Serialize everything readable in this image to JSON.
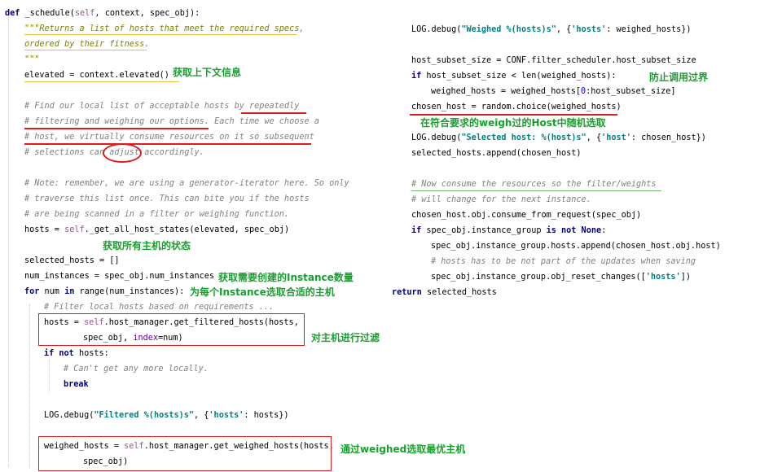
{
  "code_left": [
    [
      "def _schedule(self, context, spec_obj):"
    ],
    [
      "\"\"\"Returns a list of hosts that meet the required specs,"
    ],
    [
      "ordered by their fitness."
    ],
    [
      "\"\"\""
    ],
    [
      "elevated = context.elevated()"
    ],
    [
      "# Find our local list of acceptable hosts by repeatedly"
    ],
    [
      "# filtering and weighing our options. Each time we choose a"
    ],
    [
      "# host, we virtually consume resources on it so subsequent"
    ],
    [
      "# selections can adjust accordingly."
    ],
    [
      "# Note: remember, we are using a generator-iterator here. So only"
    ],
    [
      "# traverse this list once. This can bite you if the hosts"
    ],
    [
      "# are being scanned in a filter or weighing function."
    ],
    [
      "hosts = self._get_all_host_states(elevated, spec_obj)"
    ],
    [
      "selected_hosts = []"
    ],
    [
      "num_instances = spec_obj.num_instances"
    ],
    [
      "for num in range(num_instances):"
    ],
    [
      "# Filter local hosts based on requirements ..."
    ],
    [
      "hosts = self.host_manager.get_filtered_hosts(hosts,"
    ],
    [
      "spec_obj, index=num)"
    ],
    [
      "if not hosts:"
    ],
    [
      "# Can't get any more locally."
    ],
    [
      "break"
    ],
    [
      "LOG.debug(\"Filtered %(hosts)s\", {'hosts': hosts})"
    ],
    [
      "weighed_hosts = self.host_manager.get_weighed_hosts(hosts,"
    ],
    [
      "spec_obj)"
    ]
  ],
  "code_right": [
    [
      "LOG.debug(\"Weighed %(hosts)s\", {'hosts': weighed_hosts})"
    ],
    [
      "host_subset_size = CONF.filter_scheduler.host_subset_size"
    ],
    [
      "if host_subset_size < len(weighed_hosts):"
    ],
    [
      "weighed_hosts = weighed_hosts[0:host_subset_size]"
    ],
    [
      "chosen_host = random.choice(weighed_hosts)"
    ],
    [
      "LOG.debug(\"Selected host: %(host)s\", {'host': chosen_host})"
    ],
    [
      "selected_hosts.append(chosen_host)"
    ],
    [
      "# Now consume the resources so the filter/weights"
    ],
    [
      "# will change for the next instance."
    ],
    [
      "chosen_host.obj.consume_from_request(spec_obj)"
    ],
    [
      "if spec_obj.instance_group is not None:"
    ],
    [
      "spec_obj.instance_group.hosts.append(chosen_host.obj.host)"
    ],
    [
      "# hosts has to be not part of the updates when saving"
    ],
    [
      "spec_obj.instance_group.obj_reset_changes(['hosts'])"
    ],
    [
      "return selected_hosts"
    ]
  ],
  "annotations": {
    "elevated": "获取上下文信息",
    "all_hosts": "获取所有主机的状态",
    "num_instances": "获取需要创建的Instance数量",
    "for_each": "为每个Instance选取合适的主机",
    "filter": "对主机进行过滤",
    "weighed": "通过weighed选取最优主机",
    "prevent_over": "防止调用过界",
    "random_choice": "在符合要求的weigh过的Host中随机选取"
  },
  "colors": {
    "annotation": "#18a02e",
    "markup_red": "#d81e1e",
    "underline_yellow": "#e8c040",
    "underline_green": "#6fb66f",
    "keyword": "#000080",
    "comment": "#808080",
    "docstring": "#808000",
    "string": "#008080"
  }
}
